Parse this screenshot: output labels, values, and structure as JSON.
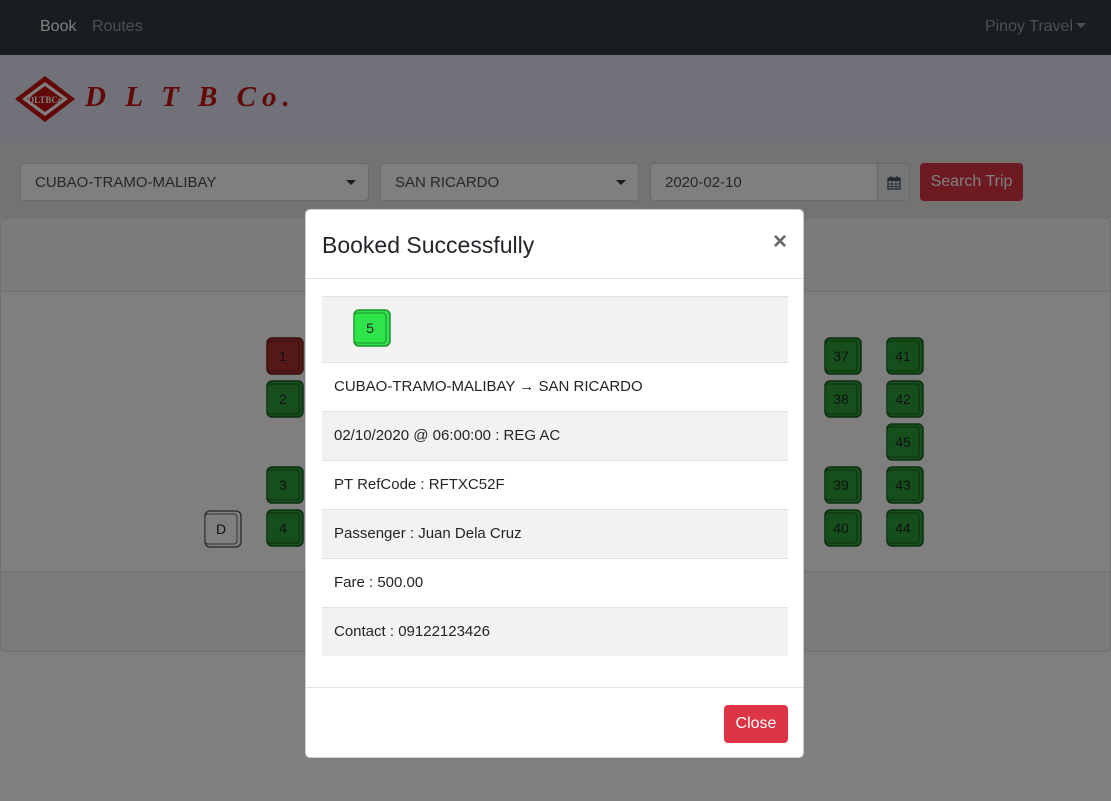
{
  "nav": {
    "links": [
      "Book",
      "Routes"
    ],
    "user_menu": "Pinoy Travel"
  },
  "brand": {
    "logo_text": "DLTBCo",
    "name": "D L T B Co."
  },
  "search": {
    "origin": "CUBAO-TRAMO-MALIBAY",
    "destination": "SAN RICARDO",
    "date": "2020-02-10",
    "button": "Search Trip"
  },
  "seats": {
    "driver": "D",
    "labels": [
      "1",
      "2",
      "3",
      "4",
      "37",
      "38",
      "39",
      "40",
      "41",
      "42",
      "43",
      "44",
      "45"
    ],
    "status_colors": {
      "available": "#2e9e38",
      "taken": "#a8312f",
      "selected": "#2ee44a",
      "driver": "#ffffff"
    },
    "taken": [
      "1"
    ]
  },
  "modal": {
    "title": "Booked Successfully",
    "close_symbol": "×",
    "selected_seat": "5",
    "route": "CUBAO-TRAMO-MALIBAY → SAN RICARDO",
    "schedule": "02/10/2020 @ 06:00:00 : REG AC",
    "refcode": "PT RefCode : RFTXC52F",
    "passenger": "Passenger : Juan Dela Cruz",
    "fare": "Fare : 500.00",
    "contact": "Contact : 09122123426",
    "close_button": "Close"
  }
}
